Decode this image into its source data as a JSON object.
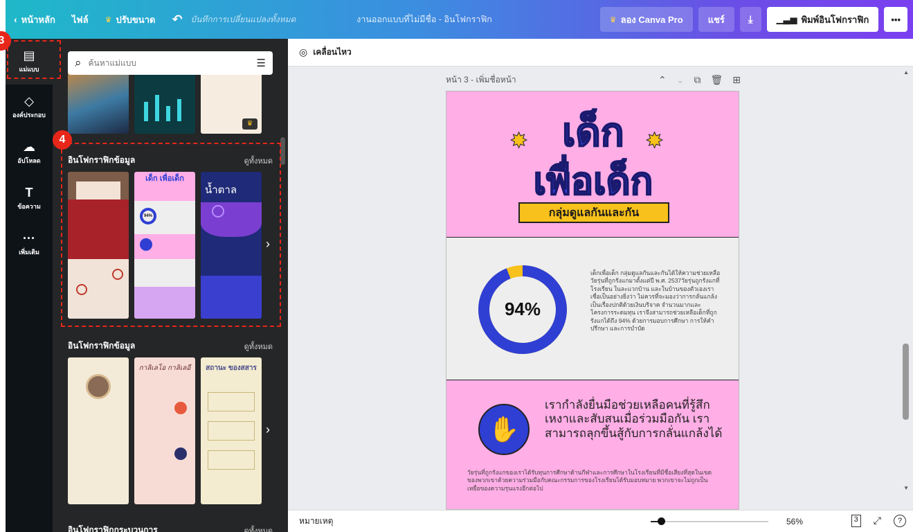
{
  "topbar": {
    "home": "หน้าหลัก",
    "file": "ไฟล์",
    "resize": "ปรับขนาด",
    "saved": "บันทึกการเปลี่ยนแปลงทั้งหมด",
    "title": "งานออกแบบที่ไม่มีชื่อ - อินโฟกราฟิก",
    "pro": "ลอง Canva Pro",
    "share": "แชร์",
    "print": "พิมพ์อินโฟกราฟิก",
    "colors": {
      "start": "#1fb8c9",
      "end": "#7a3ff0"
    }
  },
  "rail": {
    "items": [
      {
        "label": "แม่แบบ",
        "icon": "template-icon"
      },
      {
        "label": "องค์ประกอบ",
        "icon": "elements-icon"
      },
      {
        "label": "อัปโหลด",
        "icon": "upload-icon"
      },
      {
        "label": "ข้อความ",
        "icon": "text-icon"
      },
      {
        "label": "เพิ่มเติม",
        "icon": "more-icon"
      }
    ]
  },
  "panel": {
    "search_placeholder": "ค้นหาแม่แบบ",
    "sections": [
      {
        "title": "อินโฟกราฟิกข้อมูล",
        "see_all": "ดูทั้งหมด"
      },
      {
        "title": "อินโฟกราฟิกข้อมูล",
        "see_all": "ดูทั้งหมด"
      },
      {
        "title": "อินโฟกราฟิกกระบวนการ",
        "see_all": "ดูทั้งหมด"
      }
    ],
    "thumb_texts": {
      "t2": "เด็ก เพื่อเด็ก",
      "t2_pct": "94%",
      "t3": "น้ำตาล",
      "r2_t2": "กาลิเลโอ กาลิเลอี",
      "r2_t3": "สถานะ ของสสาร"
    }
  },
  "canvas": {
    "animate": "เคลื่อนไหว",
    "page_label": "หน้า 3 - เพิ่มชื่อหน้า",
    "design": {
      "title_line1": "เด็ก",
      "title_line2": "เพื่อเด็ก",
      "badge": "กลุ่มดูแลกันและกัน",
      "percent": "94%",
      "percent_value": 94,
      "para1": "เด็กเพื่อเด็ก กลุ่มดูแลกันและกันได้ให้ความช่วยเหลือวัยรุ่นที่ถูกรังแกมาตั้งแต่ปี พ.ศ. 2537วัยรุ่นถูกรังแกที่โรงเรียน ในละแวกบ้าน และในบ้านของตัวเองเราเชื่อเป็นอย่างยิ่งว่า ไม่ควรที่จะมองว่าการกลั่นแกล้งเป็นเรื่องปกติด้วยเงินบริจาค จำนวนมากและโครงการระดมทุน เราจึงสามารถช่วยเหลือเด็กที่ถูกรังแกได้ถึง 94% ด้วยการมอบการศึกษา การให้คำปรึกษา และการบำบัด",
      "s3_title": "เรากำลังยื่นมือช่วยเหลือคนที่รู้สึกเหงาและสับสนเมื่อร่วมมือกัน เราสามารถลุกขึ้นสู้กับการกลั่นแกล้งได้",
      "para2": "วัยรุ่นที่ถูกรังแกของเราได้รับทุนการศึกษาด้านกีฬาและการศึกษาในโรงเรียนที่มีชื่อเสียงที่สุดในเขตของพวกเขาด้วยความร่วมมือกับคณะกรรมการของโรงเรียนได้รับมอบหมาย พวกเขาจะไม่ถูกเป็นเหยื่อของความรุนแรงอีกต่อไป",
      "colors": {
        "pink": "#ffaee6",
        "blue": "#2f3fd4",
        "yellow": "#f8c11b"
      }
    }
  },
  "bottombar": {
    "notes": "หมายเหตุ",
    "zoom": "56%",
    "page_count": "3",
    "zoom_level": 0.06
  },
  "annotations": {
    "a3": "3",
    "a4": "4"
  }
}
